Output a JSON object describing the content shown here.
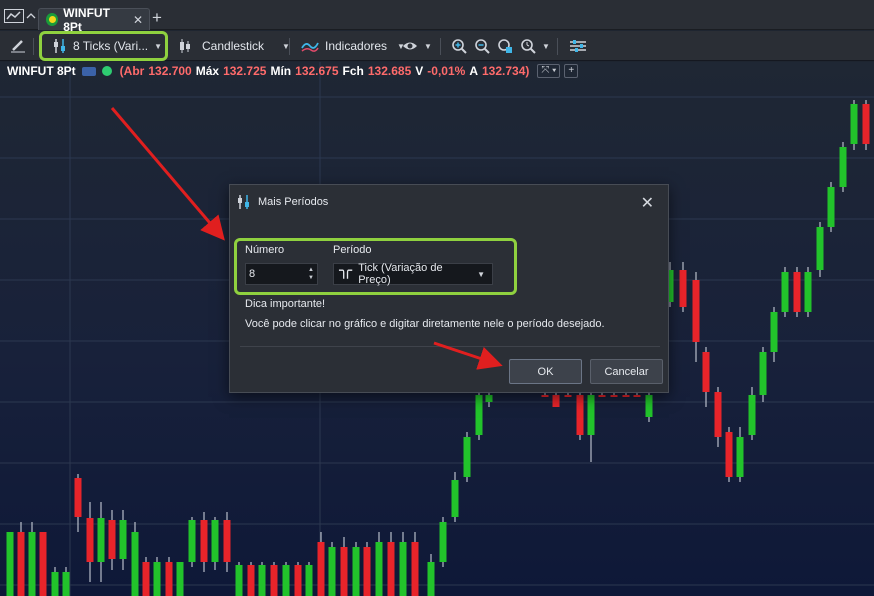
{
  "tab": {
    "title": "WINFUT 8Pt",
    "close": "✕",
    "add": "+"
  },
  "toolbar": {
    "period_label": "8 Ticks (Vari...",
    "chart_type_label": "Candlestick",
    "indicators_label": "Indicadores"
  },
  "info": {
    "symbol": "WINFUT 8Pt",
    "open_label": "(Abr",
    "open": "132.700",
    "high_label": "Máx",
    "high": "132.725",
    "low_label": "Mín",
    "low": "132.675",
    "close_label": "Fch",
    "close": "132.685",
    "var_label": "V",
    "var": "-0,01%",
    "last_label": "A",
    "last": "132.734)",
    "add_button": "+"
  },
  "dialog": {
    "title": "Mais Períodos",
    "close": "✕",
    "number_label": "Número",
    "number_value": "8",
    "period_label": "Período",
    "period_value": "Tick (Variação de Preço)",
    "hint_title": "Dica importante!",
    "hint_text": "Você pode clicar no gráfico e digitar diretamente nele o período desejado.",
    "ok_label": "OK",
    "cancel_label": "Cancelar"
  },
  "colors": {
    "up": "#22c32b",
    "down": "#e8242a",
    "highlight": "#8fd13f",
    "arrow": "#e01f1f"
  },
  "icons": [
    "chart-line-icon",
    "flag-brazil-icon",
    "pencil-icon",
    "period-sliders-icon",
    "candlestick-icon",
    "indicators-icon",
    "eye-icon",
    "zoom-in-icon",
    "zoom-out-icon",
    "zoom-fit-icon",
    "zoom-time-icon",
    "settings-icon",
    "tick-shape-icon"
  ]
}
